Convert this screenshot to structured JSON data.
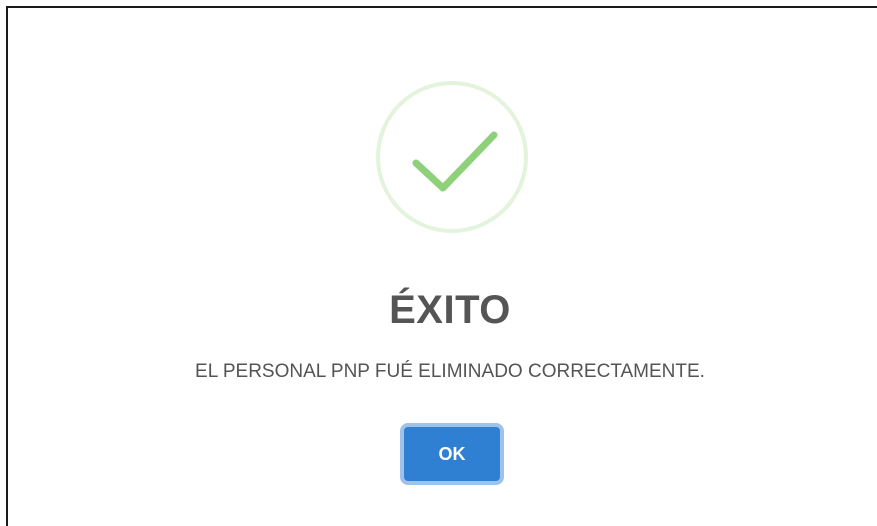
{
  "dialog": {
    "icon": "success-check-icon",
    "title": "ÉXITO",
    "message": "EL PERSONAL PNP FUÉ ELIMINADO CORRECTAMENTE.",
    "ok_label": "OK"
  },
  "colors": {
    "check": "#8fd07b",
    "ring": "#e3f3dc",
    "button": "#2f7fd3",
    "button_focus_ring": "#9ec2ea",
    "title": "#555555",
    "message": "#545454"
  }
}
